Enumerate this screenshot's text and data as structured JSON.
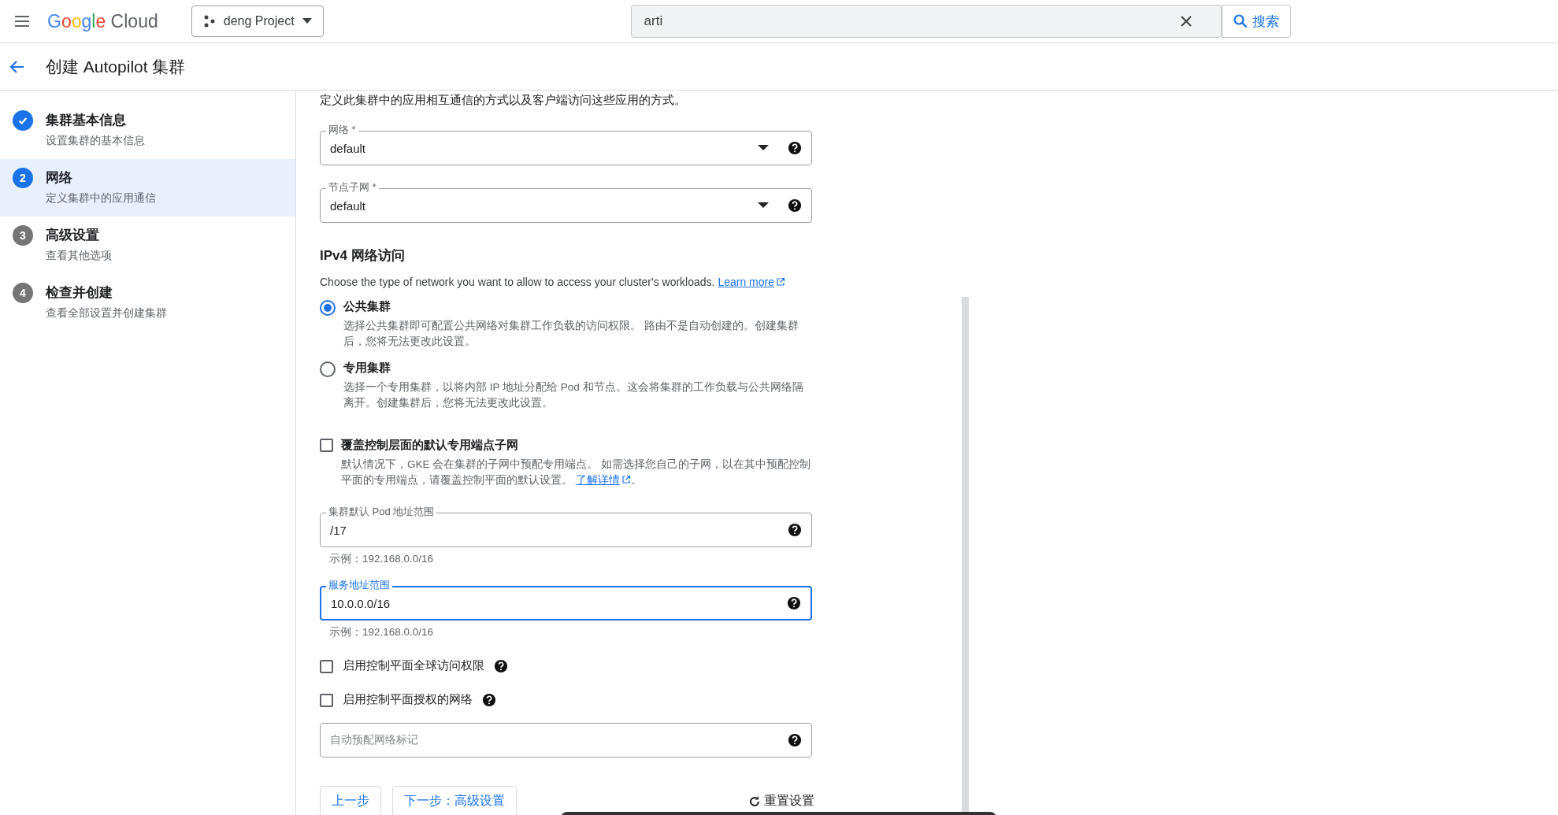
{
  "topbar": {
    "logo": "Google Cloud",
    "project": "deng Project",
    "search": {
      "value": "arti"
    },
    "search_button": "搜索"
  },
  "header": {
    "title": "创建 Autopilot 集群"
  },
  "steps": [
    {
      "completed": true,
      "label": "集群基本信息",
      "sublabel": "设置集群的基本信息",
      "selected": false
    },
    {
      "completed": false,
      "number": "2",
      "label": "网络",
      "sublabel": "定义集群中的应用通信",
      "selected": true
    },
    {
      "completed": false,
      "number": "3",
      "label": "高级设置",
      "sublabel": "查看其他选项",
      "selected": false
    },
    {
      "completed": false,
      "number": "4",
      "label": "检查并创建",
      "sublabel": "查看全部设置并创建集群",
      "selected": false
    }
  ],
  "form": {
    "intro": "定义此集群中的应用相互通信的方式以及客户端访问这些应用的方式。",
    "selects": [
      {
        "label": "网络 *",
        "value": "default"
      },
      {
        "label": "节点子网 *",
        "value": "default"
      }
    ],
    "ipv4": {
      "heading": "IPv4 网络访问",
      "description": "Choose the type of network you want to allow to access your cluster's workloads.",
      "link": "Learn more",
      "options": [
        {
          "label": "公共集群",
          "description": "选择公共集群即可配置公共网络对集群工作负载的访问权限。 路由不是自动创建的。创建集群后，您将无法更改此设置。",
          "selected": true
        },
        {
          "label": "专用集群",
          "description": "选择一个专用集群，以将内部 IP 地址分配给 Pod 和节点。这会将集群的工作负载与公共网络隔离开。创建集群后，您将无法更改此设置。",
          "selected": false
        }
      ]
    },
    "override": {
      "label": "覆盖控制层面的默认专用端点子网",
      "checked": false,
      "description": "默认情况下，GKE 会在集群的子网中预配专用端点。 如需选择您自己的子网，以在其中预配控制平面的专用端点，请覆盖控制平面的默认设置。 ",
      "link": "了解详情",
      "tail": "。"
    },
    "ranges": [
      {
        "label": "集群默认 Pod 地址范围",
        "value": "/17",
        "hint": "示例：192.168.0.0/16",
        "focused": false
      },
      {
        "label": "服务地址范围",
        "value": "10.0.0.0/16",
        "hint": "示例：192.168.0.0/16",
        "focused": true
      }
    ],
    "checks": [
      {
        "label": "启用控制平面全球访问权限",
        "checked": false
      },
      {
        "label": "启用控制平面授权的网络",
        "checked": false
      }
    ],
    "tags": {
      "placeholder": "自动预配网络标记"
    },
    "back_button": "上一步",
    "next_button": "下一步：高级设置",
    "reset_button": "重置设置"
  }
}
